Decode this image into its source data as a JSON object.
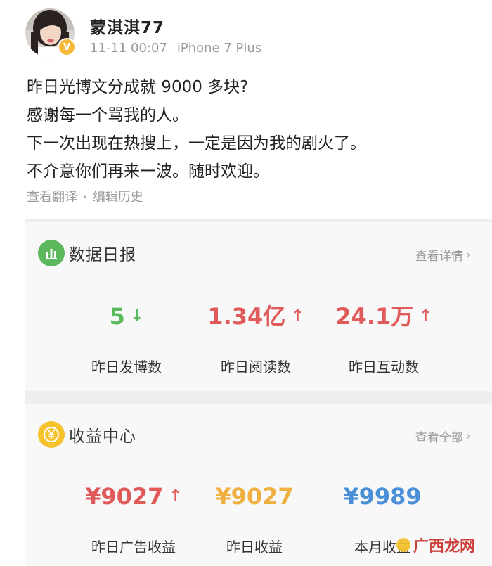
{
  "post": {
    "username": "蒙淇淇77",
    "timestamp": "11-11 00:07",
    "device": "iPhone 7 Plus",
    "lines": [
      "昨日光博文分成就 9000 多块?",
      "感谢每一个骂我的人。",
      "下一次出现在热搜上，一定是因为我的剧火了。",
      "不介意你们再来一波。随时欢迎。"
    ],
    "translate_label": "查看翻译",
    "separator": "·",
    "edit_history_label": "编辑历史"
  },
  "data_report": {
    "title": "数据日报",
    "link_label": "查看详情",
    "icon": "bar-chart-icon",
    "stats": [
      {
        "value": "5",
        "label": "昨日发博数",
        "trend": "down",
        "color": "#5cb85c"
      },
      {
        "value": "1.34亿",
        "label": "昨日阅读数",
        "trend": "up",
        "color": "#e05a5a"
      },
      {
        "value": "24.1万",
        "label": "昨日互动数",
        "trend": "up",
        "color": "#e05a5a"
      }
    ]
  },
  "income_center": {
    "title": "收益中心",
    "link_label": "查看全部",
    "icon": "yen-coin-icon",
    "stats": [
      {
        "value": "¥9027",
        "label": "昨日广告收益",
        "trend": "up",
        "color": "#e05a5a"
      },
      {
        "value": "¥9027",
        "label": "昨日收益",
        "trend": "none",
        "color": "#f0b040"
      },
      {
        "value": "¥9989",
        "label": "本月收益",
        "trend": "none",
        "color": "#4a90d9"
      }
    ]
  },
  "watermark": {
    "text": "广西龙网"
  },
  "colors": {
    "accent_green": "#5cb85c",
    "accent_red": "#e05a5a",
    "accent_gold": "#f0b040",
    "accent_blue": "#4a90d9",
    "verified_badge": "#f6b93b"
  }
}
